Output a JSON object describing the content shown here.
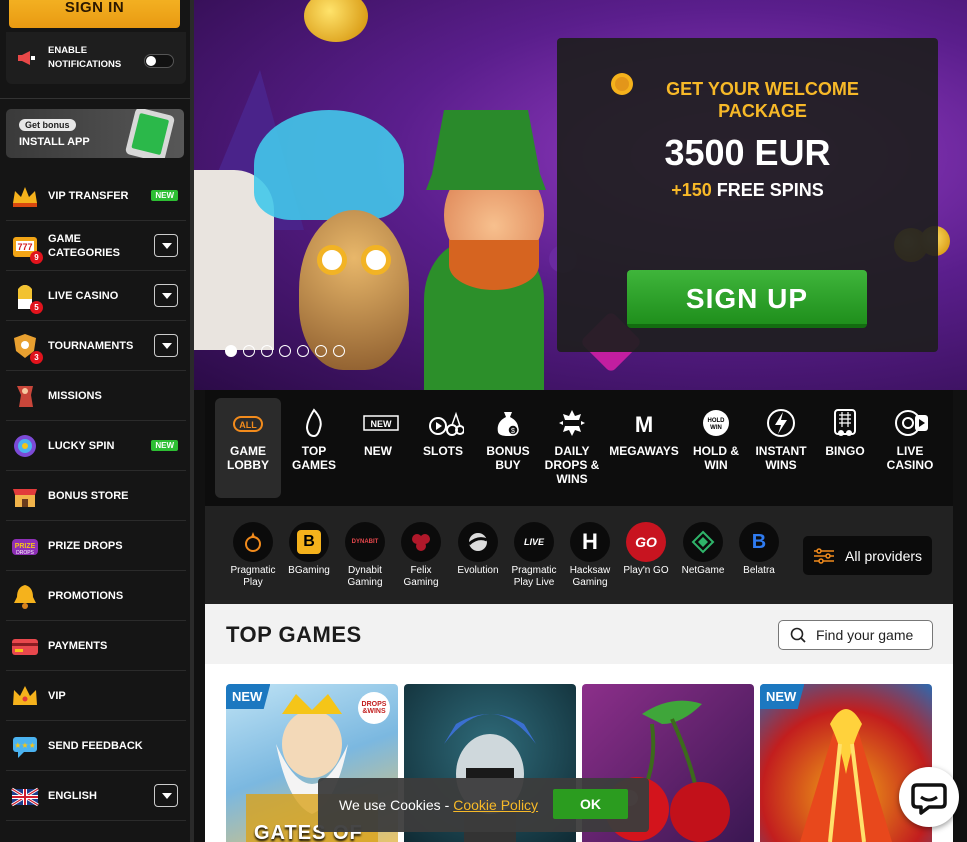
{
  "sidebar": {
    "signin_label": "SIGN IN",
    "notifications_label_1": "ENABLE",
    "notifications_label_2": "NOTIFICATIONS",
    "get_bonus": "Get bonus",
    "install_app": "INSTALL APP",
    "items": [
      {
        "label": "VIP TRANSFER",
        "icon": "crown-icon",
        "badge": "NEW"
      },
      {
        "label1": "GAME",
        "label2": "CATEGORIES",
        "icon": "slot-777-icon",
        "count": "9"
      },
      {
        "label": "LIVE CASINO",
        "icon": "dealer-icon",
        "count": "5"
      },
      {
        "label": "TOURNAMENTS",
        "icon": "shield-icon",
        "count": "3"
      },
      {
        "label": "MISSIONS",
        "icon": "missions-icon"
      },
      {
        "label": "LUCKY SPIN",
        "icon": "wheel-icon",
        "badge": "NEW"
      },
      {
        "label": "BONUS STORE",
        "icon": "store-icon"
      },
      {
        "label": "PRIZE DROPS",
        "icon": "prize-drops-icon"
      },
      {
        "label": "PROMOTIONS",
        "icon": "bell-icon"
      },
      {
        "label": "PAYMENTS",
        "icon": "card-icon"
      },
      {
        "label": "VIP",
        "icon": "vip-crown-icon"
      },
      {
        "label": "SEND FEEDBACK",
        "icon": "feedback-icon"
      },
      {
        "label": "ENGLISH",
        "icon": "uk-flag-icon"
      }
    ]
  },
  "hero": {
    "welcome_line1": "GET YOUR WELCOME",
    "welcome_line2": "PACKAGE",
    "amount": "3500 EUR",
    "spins_plus": "+150",
    "spins_text": "FREE SPINS",
    "signup_label": "SIGN UP",
    "slides_total": 7,
    "slide_active": 1
  },
  "categories": [
    {
      "label1": "GAME",
      "label2": "LOBBY",
      "icon_text": "ALL"
    },
    {
      "label1": "TOP",
      "label2": "GAMES"
    },
    {
      "label1": "NEW",
      "label2": "",
      "icon_text": "NEW"
    },
    {
      "label1": "SLOTS",
      "label2": ""
    },
    {
      "label1": "BONUS",
      "label2": "BUY"
    },
    {
      "label1": "DAILY",
      "label2": "DROPS &",
      "label3": "WINS"
    },
    {
      "label1": "MEGAWAYS",
      "label2": "",
      "icon_text": "M"
    },
    {
      "label1": "HOLD &",
      "label2": "WIN",
      "icon_text": "HOLD WIN"
    },
    {
      "label1": "INSTANT",
      "label2": "WINS"
    },
    {
      "label1": "BINGO",
      "label2": ""
    },
    {
      "label1": "LIVE",
      "label2": "CASINO"
    }
  ],
  "providers": [
    {
      "label1": "Pragmatic",
      "label2": "Play"
    },
    {
      "label1": "BGaming",
      "label2": "",
      "icon_text": "B"
    },
    {
      "label1": "Dynabit",
      "label2": "Gaming",
      "icon_text": "DYNABIT"
    },
    {
      "label1": "Felix",
      "label2": "Gaming"
    },
    {
      "label1": "Evolution",
      "label2": ""
    },
    {
      "label1": "Pragmatic",
      "label2": "Play Live",
      "icon_text": "LIVE"
    },
    {
      "label1": "Hacksaw",
      "label2": "Gaming",
      "icon_text": "H"
    },
    {
      "label1": "Play'n GO",
      "label2": "",
      "icon_text": "GO"
    },
    {
      "label1": "NetGame",
      "label2": ""
    },
    {
      "label1": "Belatra",
      "label2": "",
      "icon_text": "B"
    }
  ],
  "all_providers": "All providers",
  "top_games": {
    "title": "TOP GAMES",
    "search_placeholder": "Find your game",
    "games": [
      {
        "badge": "NEW",
        "overlay": "DROPS &WINS",
        "caption": "GATES OF"
      },
      {
        "badge": ""
      },
      {
        "badge": ""
      },
      {
        "badge": "NEW"
      }
    ]
  },
  "cookie": {
    "text": "We use Cookies - ",
    "link": "Cookie Policy",
    "ok": "OK"
  },
  "colors": {
    "accent_gold": "#f7b928",
    "signup_green": "#2b9c1f",
    "new_badge_green": "#2dbf33",
    "new_game_blue": "#1c78c0"
  }
}
